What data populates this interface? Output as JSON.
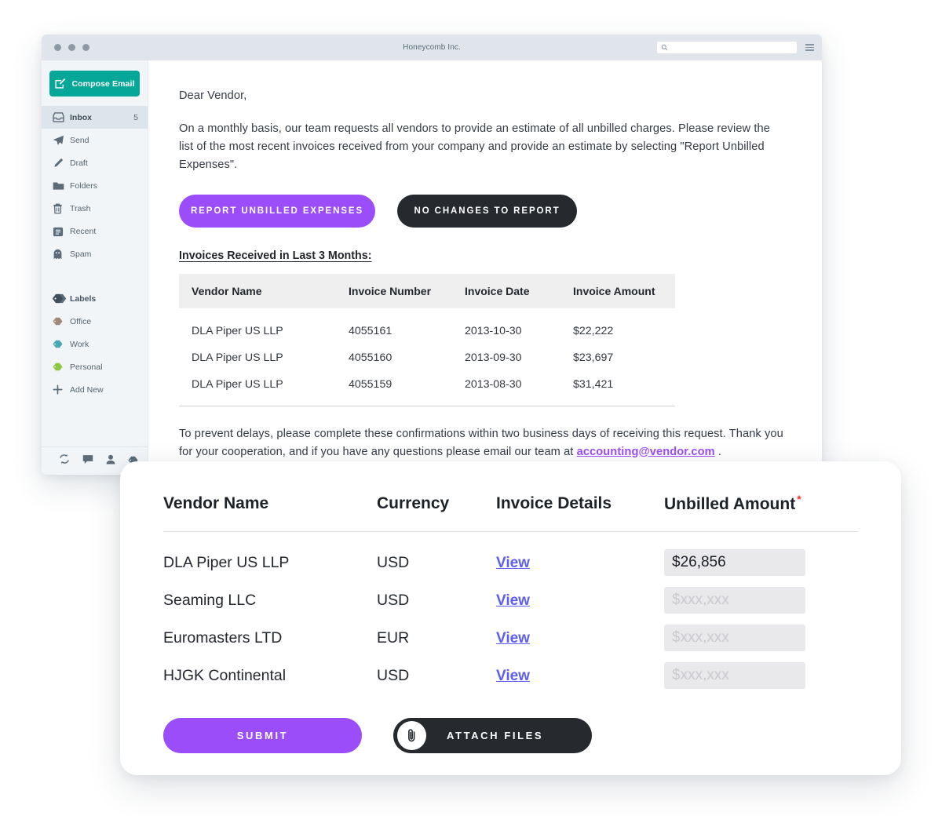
{
  "window": {
    "title": "Honeycomb Inc.",
    "search_placeholder": "",
    "search_value": "",
    "icons": {
      "search": "search-icon",
      "menu": "hamburger-icon"
    }
  },
  "sidebar": {
    "compose_label": "Compose Email",
    "items": [
      {
        "label": "Inbox",
        "badge": "5",
        "icon": "inbox-icon",
        "active": true
      },
      {
        "label": "Send",
        "badge": "",
        "icon": "send-icon",
        "active": false
      },
      {
        "label": "Draft",
        "badge": "",
        "icon": "pencil-icon",
        "active": false
      },
      {
        "label": "Folders",
        "badge": "",
        "icon": "folder-icon",
        "active": false
      },
      {
        "label": "Trash",
        "badge": "",
        "icon": "trash-icon",
        "active": false
      },
      {
        "label": "Recent",
        "badge": "",
        "icon": "recent-icon",
        "active": false
      },
      {
        "label": "Spam",
        "badge": "",
        "icon": "ghost-icon",
        "active": false
      }
    ],
    "labels_header": "Labels",
    "labels": [
      {
        "label": "Office",
        "color": "#a1897a",
        "icon": "tag-icon"
      },
      {
        "label": "Work",
        "color": "#4aa8b2",
        "icon": "tag-icon"
      },
      {
        "label": "Personal",
        "color": "#8dc63f",
        "icon": "tag-icon"
      }
    ],
    "add_new_label": "Add New",
    "footer_icons": [
      "sync-icon",
      "chat-icon",
      "contact-icon",
      "tag-icon"
    ]
  },
  "email": {
    "greeting": "Dear Vendor,",
    "body": "On a monthly basis, our team requests all vendors to provide an estimate of all unbilled charges. Please review the list of the most recent invoices received from your company and provide an estimate by selecting \"Report Unbilled Expenses\".",
    "primary_button": "REPORT UNBILLED EXPENSES",
    "secondary_button": "NO CHANGES TO REPORT",
    "table_heading": "Invoices Received in Last 3 Months:",
    "invoice_table": {
      "columns": [
        "Vendor Name",
        "Invoice Number",
        "Invoice Date",
        "Invoice Amount"
      ],
      "rows": [
        [
          "DLA Piper US LLP",
          "4055161",
          "2013-10-30",
          "$22,222"
        ],
        [
          "DLA Piper US LLP",
          "4055160",
          "2013-09-30",
          "$23,697"
        ],
        [
          "DLA Piper US LLP",
          "4055159",
          "2013-08-30",
          "$31,421"
        ]
      ]
    },
    "closing_before": "To prevent delays, please complete these confirmations within two business days of receiving this request. Thank you for your cooperation, and if you have any questions please email our team at ",
    "closing_link": "accounting@vendor.com",
    "closing_after": " ."
  },
  "modal": {
    "columns": [
      "Vendor Name",
      "Currency",
      "Invoice Details",
      "Unbilled Amount"
    ],
    "required_marker": "*",
    "rows": [
      {
        "vendor": "DLA Piper US LLP",
        "currency": "USD",
        "details_link": "View",
        "amount_value": "$26,856",
        "amount_placeholder": ""
      },
      {
        "vendor": "Seaming LLC",
        "currency": "USD",
        "details_link": "View",
        "amount_value": "",
        "amount_placeholder": "$xxx,xxx"
      },
      {
        "vendor": "Euromasters LTD",
        "currency": "EUR",
        "details_link": "View",
        "amount_value": "",
        "amount_placeholder": "$xxx,xxx"
      },
      {
        "vendor": "HJGK Continental",
        "currency": "USD",
        "details_link": "View",
        "amount_value": "",
        "amount_placeholder": "$xxx,xxx"
      }
    ],
    "submit_label": "SUBMIT",
    "attach_label": "ATTACH FILES",
    "attach_icon": "paperclip-icon"
  },
  "colors": {
    "accent_purple": "#9b4dfa",
    "accent_teal": "#06a698",
    "dark": "#262a2f",
    "link_blue": "#5d5df0",
    "required_red": "#ff2d2d"
  }
}
